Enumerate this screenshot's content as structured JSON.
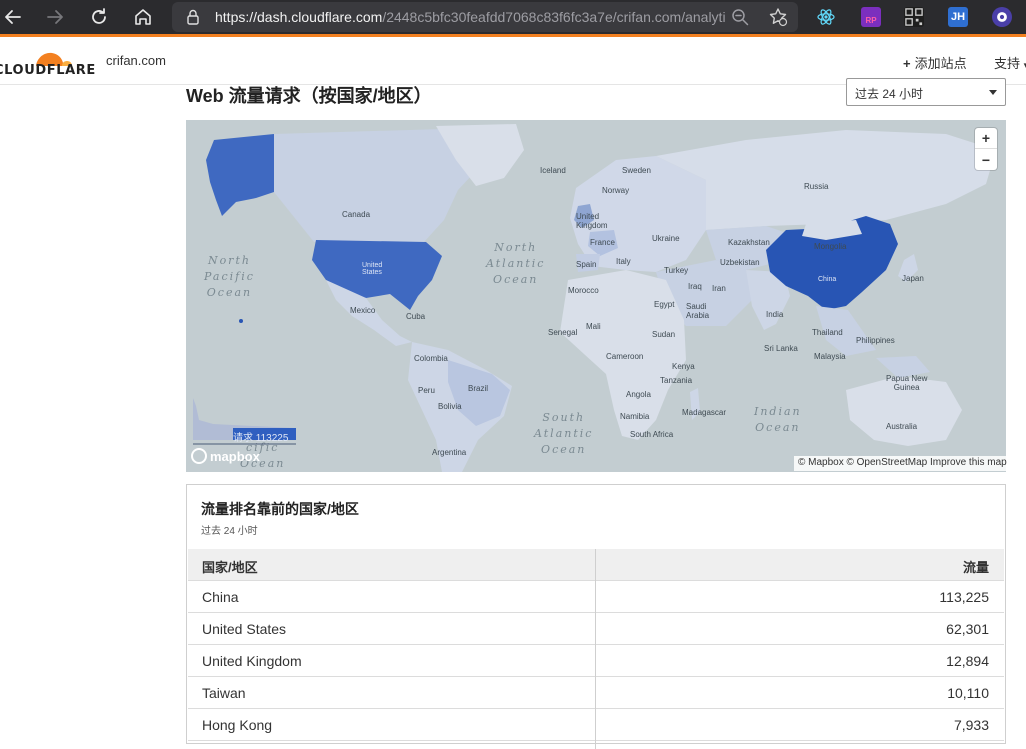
{
  "browser": {
    "url_host": "https://dash.cloudflare.com",
    "url_path": "/2448c5bfc30feafdd7068c83f6fc3a7e/crifan.com/analytics...",
    "extensions": [
      "react-devtools-icon",
      "rp-icon",
      "qr-code-icon",
      "jh-icon",
      "wallet-icon"
    ],
    "ext_labels": [
      "RP",
      "JH"
    ]
  },
  "header": {
    "logo_text": "CLOUDFLARE",
    "site_name": "crifan.com",
    "add_site": "添加站点",
    "support": "支持"
  },
  "traffic": {
    "title": "Web 流量请求（按国家/地区）",
    "time_range": "过去 24 小时"
  },
  "map": {
    "zoom_in": "+",
    "zoom_out": "−",
    "legend_label": "请求  113225",
    "mapbox_brand": "mapbox",
    "attribution": "© Mapbox © OpenStreetMap Improve this map",
    "oceans": [
      "North Pacific Ocean",
      "North Atlantic Ocean",
      "South Atlantic Ocean",
      "Indian Ocean",
      "Pacific Ocean"
    ],
    "countries": [
      "Iceland",
      "Sweden",
      "Norway",
      "Russia",
      "Canada",
      "United Kingdom",
      "France",
      "Ukraine",
      "Kazakhstan",
      "Mongolia",
      "United States",
      "Spain",
      "Italy",
      "Turkey",
      "Uzbekistan",
      "China",
      "Japan",
      "Morocco",
      "Egypt",
      "Iraq",
      "Iran",
      "Saudi Arabia",
      "Mexico",
      "Cuba",
      "Mali",
      "Sudan",
      "India",
      "Thailand",
      "Philippines",
      "Senegal",
      "Sri Lanka",
      "Malaysia",
      "Colombia",
      "Cameroon",
      "Kenya",
      "Tanzania",
      "Peru",
      "Brazil",
      "Angola",
      "Papua New Guinea",
      "Bolivia",
      "Namibia",
      "Madagascar",
      "South Africa",
      "Australia",
      "Argentina"
    ],
    "colors": {
      "max": "#2855b4",
      "high": "#3f69c1",
      "mid": "#b9c6e0",
      "low": "#d9dfe9",
      "water": "#c3cdd1"
    }
  },
  "top_countries": {
    "title": "流量排名靠前的国家/地区",
    "subtitle": "过去 24 小时",
    "columns": [
      "国家/地区",
      "流量"
    ],
    "rows": [
      {
        "country": "China",
        "traffic": "113,225"
      },
      {
        "country": "United States",
        "traffic": "62,301"
      },
      {
        "country": "United Kingdom",
        "traffic": "12,894"
      },
      {
        "country": "Taiwan",
        "traffic": "10,110"
      },
      {
        "country": "Hong Kong",
        "traffic": "7,933"
      }
    ]
  }
}
